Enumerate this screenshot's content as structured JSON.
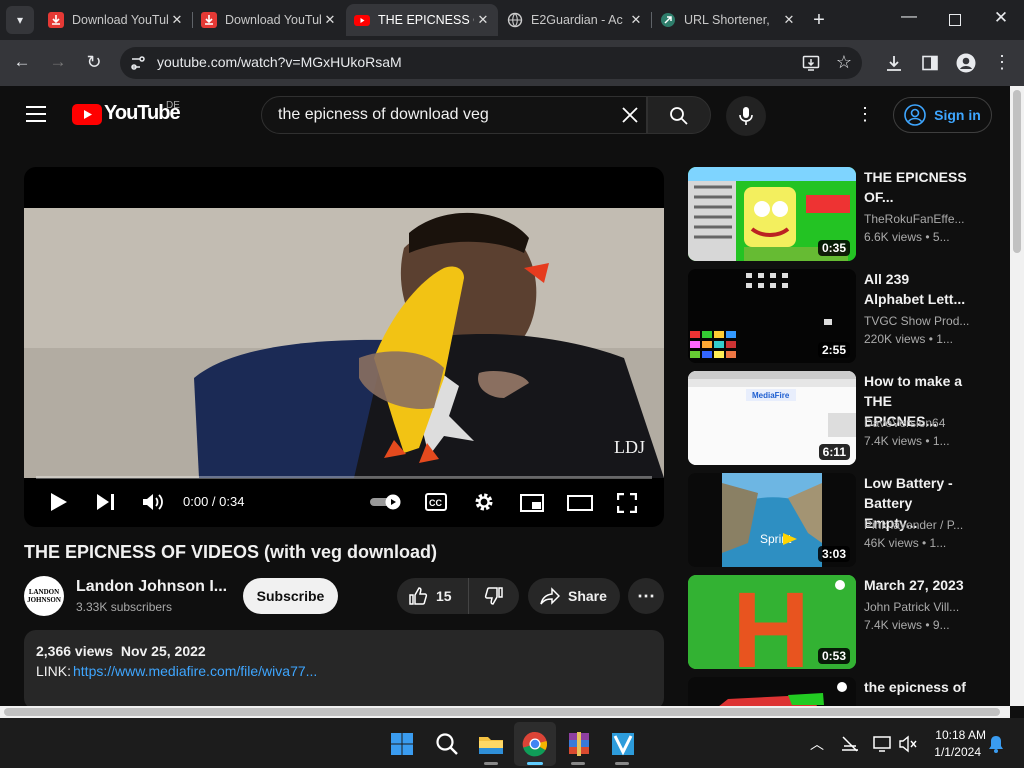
{
  "browser": {
    "tabs": [
      {
        "title": "Download YouTube",
        "favicon": "download-favicon"
      },
      {
        "title": "Download YouTube",
        "favicon": "download-favicon"
      },
      {
        "title": "THE EPICNESS OF",
        "favicon": "youtube-favicon"
      },
      {
        "title": "E2Guardian - Ac",
        "favicon": "globe-favicon"
      },
      {
        "title": "URL Shortener,",
        "favicon": "url-favicon"
      }
    ],
    "new_tab": "+",
    "url": "youtube.com/watch?v=MGxHUkoRsaM"
  },
  "youtube": {
    "logo": "YouTube",
    "country": "DE",
    "search_query": "the epicness of download veg",
    "sign_in": "Sign in",
    "video": {
      "time": "0:00 / 0:34",
      "watermark": "LDJ",
      "title": "THE EPICNESS OF VIDEOS (with veg download)",
      "channel": "Landon Johnson I...",
      "channel_avatar_text": "LANDON JOHNSON",
      "subscribers": "3.33K subscribers",
      "subscribe": "Subscribe",
      "likes": "15",
      "share": "Share",
      "stats": "2,366 views  Nov 25, 2022",
      "link_label": "LINK:",
      "link": "https://www.mediafire.com/file/wiva77..."
    },
    "recommendations": [
      {
        "title_lines": [
          "THE EPICNESS",
          "OF..."
        ],
        "channel": "TheRokuFanEffe...",
        "meta": "6.6K views  • 5...",
        "duration": "0:35",
        "thumb_colors": [
          "#1ec81e",
          "#8de0ff"
        ]
      },
      {
        "title_lines": [
          "All 239",
          "Alphabet Lett..."
        ],
        "channel": "TVGC Show Prod...",
        "meta": "220K views  • 1...",
        "duration": "2:55",
        "thumb_colors": [
          "#050505",
          "#303030"
        ]
      },
      {
        "title_lines": [
          "How to make a",
          "THE EPICNES..."
        ],
        "channel": "DaveVersion64",
        "meta": "7.4K views  • 1...",
        "duration": "6:11",
        "thumb_colors": [
          "#ffffff",
          "#e8eefc"
        ],
        "thumb_text": "MediaFire"
      },
      {
        "title_lines": [
          "Low Battery -",
          "Battery Empty..."
        ],
        "channel": "Pink lavender / P...",
        "meta": "46K views  • 1...",
        "duration": "3:03",
        "thumb_colors": [
          "#0a0a0a",
          "#4aa3d6"
        ],
        "thumb_text": "Sprint"
      },
      {
        "title_lines": [
          "March 27, 2023",
          ""
        ],
        "channel": "John Patrick Vill...",
        "meta": "7.4K views  • 9...",
        "duration": "0:53",
        "thumb_colors": [
          "#33b233",
          "#e8541f"
        ],
        "thumb_text": "H"
      },
      {
        "title_lines": [
          "the epicness of",
          ""
        ],
        "channel": "",
        "meta": "",
        "duration": "",
        "thumb_colors": [
          "#0a0a0a",
          "#d33"
        ]
      }
    ]
  },
  "taskbar": {
    "time": "10:18 AM",
    "date": "1/1/2024"
  }
}
